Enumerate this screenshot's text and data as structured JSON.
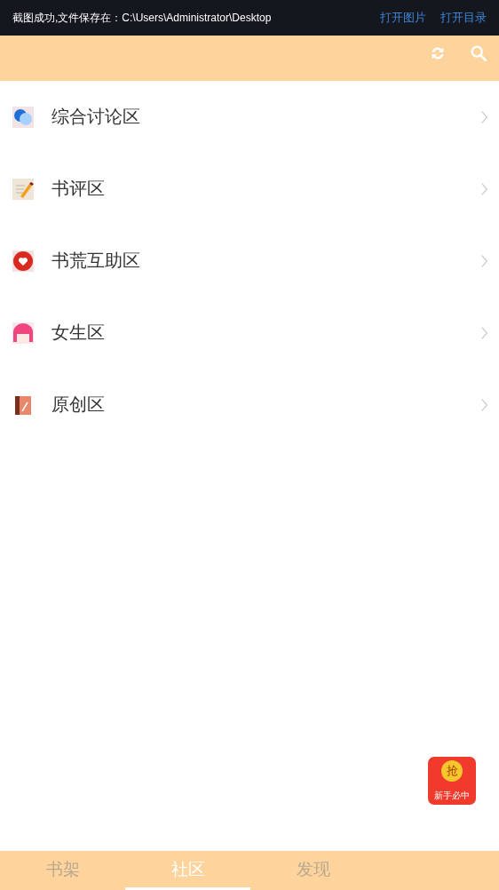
{
  "toast": {
    "message": "截图成功,文件保存在：C:\\Users\\Administrator\\Desktop",
    "actions": [
      "打开图片",
      "打开目录"
    ]
  },
  "forums": [
    {
      "kind": "chat",
      "label": "综合讨论区"
    },
    {
      "kind": "review",
      "label": "书评区"
    },
    {
      "kind": "heart",
      "label": "书荒互助区"
    },
    {
      "kind": "girl",
      "label": "女生区"
    },
    {
      "kind": "book",
      "label": "原创区"
    }
  ],
  "promo": {
    "coin": "抢",
    "caption": "新手必中"
  },
  "tabs": [
    {
      "label": "书架",
      "selected": false
    },
    {
      "label": "社区",
      "selected": true
    },
    {
      "label": "发现",
      "selected": false
    }
  ]
}
